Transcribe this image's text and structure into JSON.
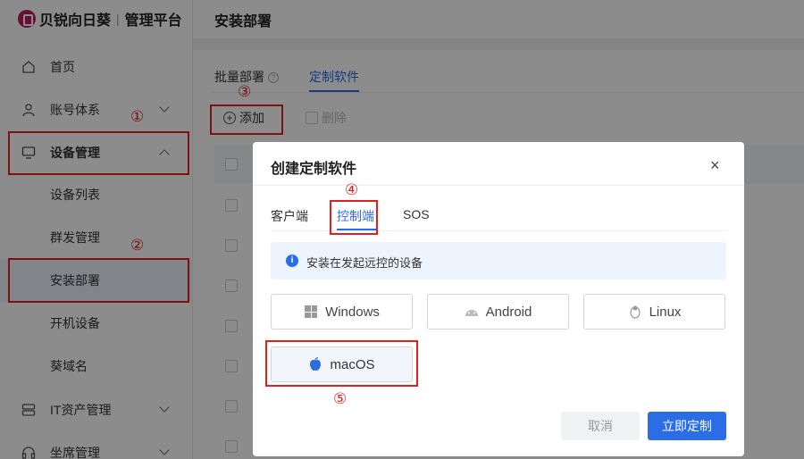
{
  "app": {
    "brand": "贝锐向日葵",
    "separator": "|",
    "subtitle": "管理平台"
  },
  "sidebar": {
    "items": [
      {
        "label": "首页",
        "icon": "home-icon"
      },
      {
        "label": "账号体系",
        "icon": "user-icon"
      },
      {
        "label": "设备管理",
        "icon": "monitor-icon"
      },
      {
        "label": "IT资产管理",
        "icon": "server-icon"
      },
      {
        "label": "坐席管理",
        "icon": "headset-icon"
      }
    ],
    "sub_items": [
      "设备列表",
      "群发管理",
      "安装部署",
      "开机设备",
      "葵域名"
    ]
  },
  "page": {
    "title": "安装部署"
  },
  "main": {
    "tabs": [
      {
        "label": "批量部署"
      },
      {
        "label": "定制软件"
      }
    ],
    "toolbar": {
      "add_label": "添加",
      "delete_label": "删除"
    }
  },
  "modal": {
    "title": "创建定制软件",
    "close": "×",
    "tabs": [
      "客户端",
      "控制端",
      "SOS"
    ],
    "info": "安装在发起远控的设备",
    "os_options": [
      "Windows",
      "Android",
      "Linux",
      "macOS"
    ],
    "cancel_label": "取消",
    "confirm_label": "立即定制"
  },
  "annotations": [
    "①",
    "②",
    "③",
    "④",
    "⑤"
  ],
  "colors": {
    "accent": "#2b6de5",
    "annotation": "#e02020",
    "brand": "#c2185b"
  }
}
